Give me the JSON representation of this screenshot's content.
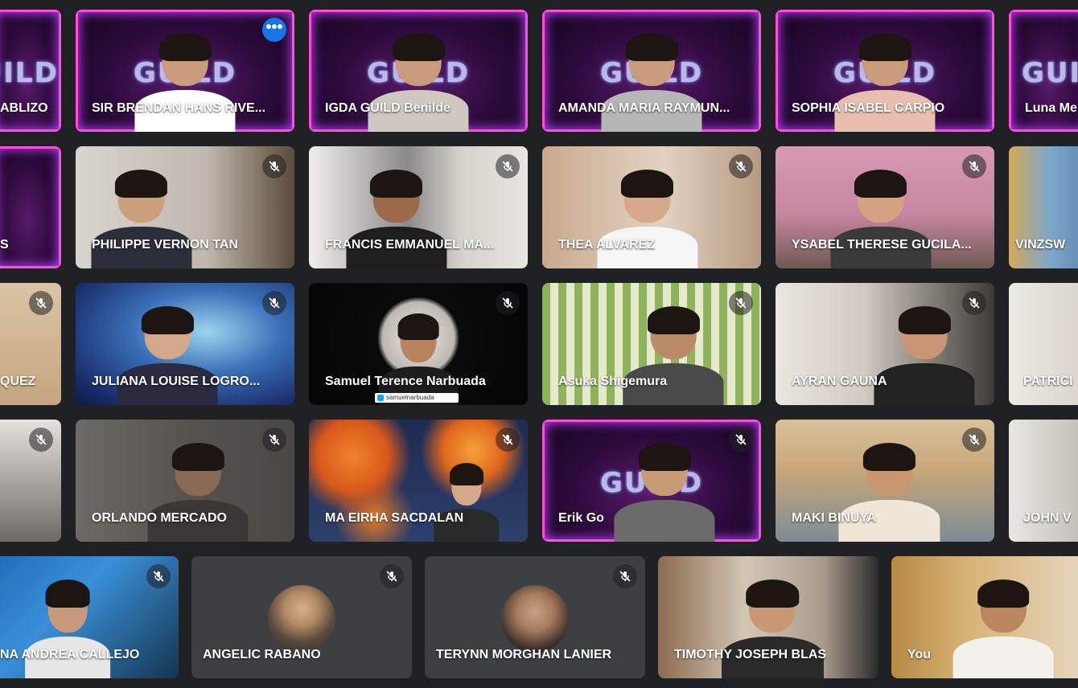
{
  "meeting": {
    "participants": [
      {
        "name": "ABLIZO"
      },
      {
        "name": "SIR BRENDAN HANS RIVE..."
      },
      {
        "name": "IGDA GUILD Benilde"
      },
      {
        "name": "AMANDA MARIA RAYMUN..."
      },
      {
        "name": "SOPHIA ISABEL CARPIO"
      },
      {
        "name": "Luna Me"
      },
      {
        "name": "S"
      },
      {
        "name": "PHILIPPE VERNON TAN"
      },
      {
        "name": "FRANCIS EMMANUEL MA..."
      },
      {
        "name": "THEA ALVAREZ"
      },
      {
        "name": "YSABEL THERESE GUCILA..."
      },
      {
        "name": "VINZSW"
      },
      {
        "name": "QUEZ"
      },
      {
        "name": "JULIANA LOUISE LOGRO..."
      },
      {
        "name": "Samuel Terence Narbuada",
        "twitter": "samuelnarbuada"
      },
      {
        "name": "Asuka Shigemura"
      },
      {
        "name": "AYRAN GAUNA"
      },
      {
        "name": "PATRICI"
      },
      {
        "name": "ORLANDO MERCADO"
      },
      {
        "name": "MA EIRHA SACDALAN"
      },
      {
        "name": "Erik Go"
      },
      {
        "name": "MAKI BINUYA"
      },
      {
        "name": "JOHN V"
      },
      {
        "name": "NA ANDREA CALLEJO"
      },
      {
        "name": "ANGELIC RABANO"
      },
      {
        "name": "TERYNN MORGHAN LANIER"
      },
      {
        "name": "TIMOTHY JOSEPH BLAS"
      },
      {
        "name": "You"
      }
    ],
    "logo_text": "GUILD",
    "more_options_glyph": "•••",
    "accent_color": "#1a73e8",
    "active_speaker_color": "#8ab4f8",
    "icons": {
      "mic_muted": "mic-off-icon",
      "more": "more-options-icon"
    }
  }
}
